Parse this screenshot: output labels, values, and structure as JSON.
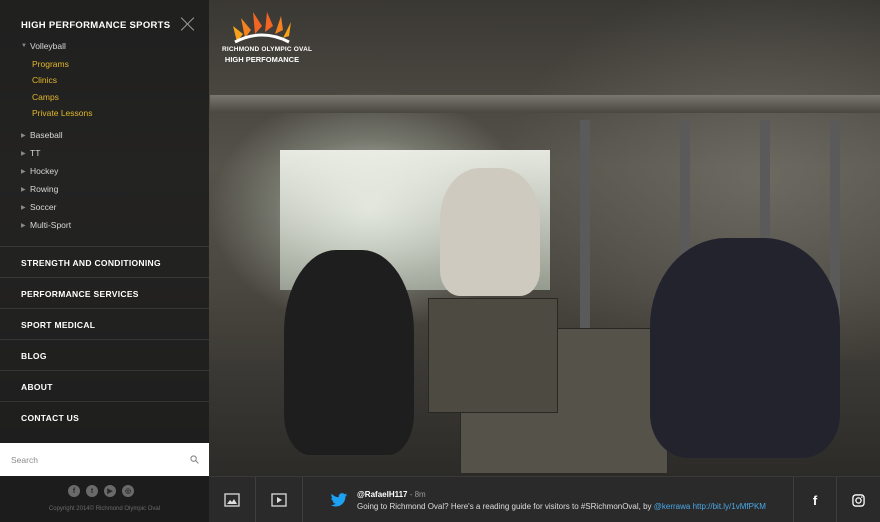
{
  "sidebar": {
    "title": "HIGH PERFORMANCE SPORTS",
    "sub_items": [
      {
        "label": "Volleyball",
        "expanded": true
      },
      {
        "label": "Baseball"
      },
      {
        "label": "TT"
      },
      {
        "label": "Hockey"
      },
      {
        "label": "Rowing"
      },
      {
        "label": "Soccer"
      },
      {
        "label": "Multi-Sport"
      }
    ],
    "volleyball_children": [
      "Programs",
      "Clinics",
      "Camps",
      "Private Lessons"
    ],
    "main_items": [
      "STRENGTH AND CONDITIONING",
      "PERFORMANCE SERVICES",
      "SPORT MEDICAL",
      "BLOG",
      "ABOUT",
      "CONTACT US"
    ],
    "search_placeholder": "Search",
    "social_icons": [
      "facebook-icon",
      "twitter-icon",
      "youtube-icon",
      "instagram-icon"
    ],
    "copyright": "Copyright 2014© Richmond Olympic Oval"
  },
  "logo": {
    "line1": "RICHMOND OLYMPIC OVAL",
    "line2": "HIGH PERFOMANCE"
  },
  "colors": {
    "accent_gold": "#e3b82a",
    "link_blue": "#4aa8e8",
    "twitter_blue": "#1da1f2"
  },
  "bottombar": {
    "media_buttons": [
      "image-gallery-icon",
      "video-play-icon"
    ],
    "tweet": {
      "handle": "@RafaelH117",
      "separator": " - ",
      "time": "8m",
      "text": "Going to Richmond Oval? Here's a reading guide for visitors to #SRichmonOval, by ",
      "mention": "@kerrawa",
      "link": "http://bit.ly/1vMfPKM"
    },
    "social": [
      "facebook-icon",
      "instagram-icon"
    ]
  }
}
